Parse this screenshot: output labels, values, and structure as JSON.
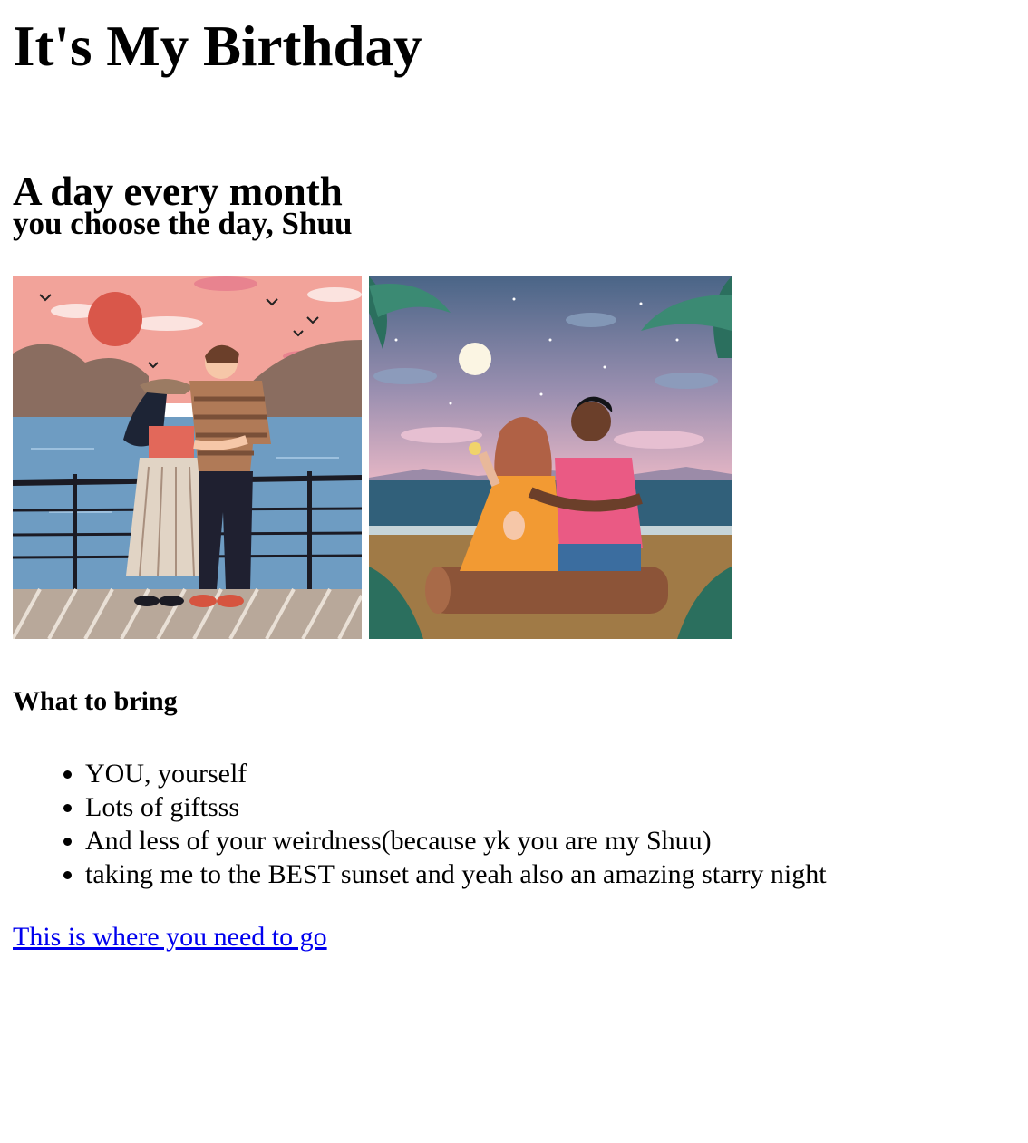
{
  "page": {
    "title": "It's My Birthday",
    "subtitle": "A day every month",
    "tagline": "you choose the day, Shuu",
    "images": [
      {
        "alt": "couple-sunset-illustration",
        "icon": "sunset-couple-image"
      },
      {
        "alt": "couple-starry-night-illustration",
        "icon": "night-couple-image"
      }
    ],
    "bring_heading": "What to bring",
    "bring_items": [
      "YOU, yourself",
      "Lots of giftsss",
      "And less of your weirdness(because yk you are my Shuu)",
      "taking me to the BEST sunset and yeah also an amazing starry night"
    ],
    "link_text": "This is where you need to go"
  },
  "colors": {
    "link": "#0000ee",
    "text": "#000000",
    "background": "#ffffff"
  }
}
